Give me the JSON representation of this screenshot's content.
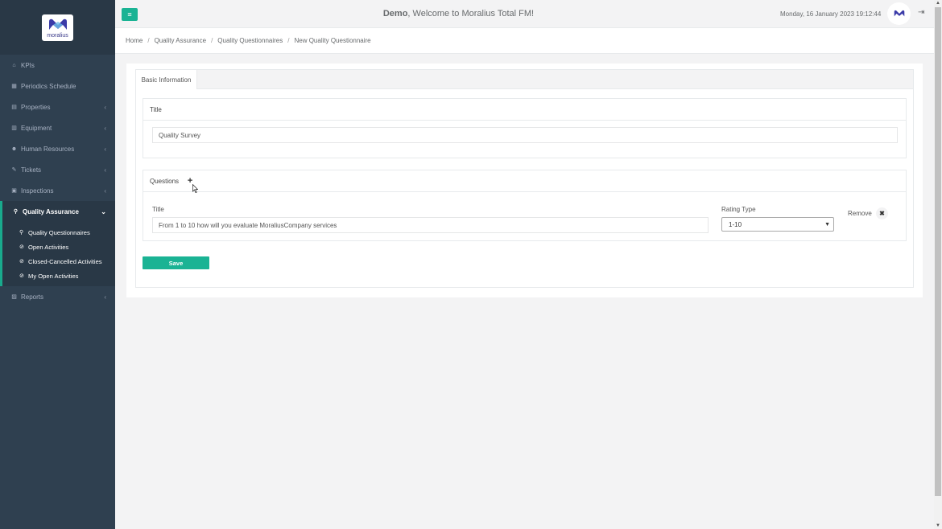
{
  "logo": {
    "text": "moralius"
  },
  "sidebar": {
    "items": [
      {
        "label": "KPIs",
        "icon": "home-icon",
        "glyph": "⌂",
        "chevron": false
      },
      {
        "label": "Periodics Schedule",
        "icon": "calendar-icon",
        "glyph": "▦",
        "chevron": false
      },
      {
        "label": "Properties",
        "icon": "building-icon",
        "glyph": "▤",
        "chevron": true
      },
      {
        "label": "Equipment",
        "icon": "clipboard-icon",
        "glyph": "▥",
        "chevron": true
      },
      {
        "label": "Human Resources",
        "icon": "users-icon",
        "glyph": "☻",
        "chevron": true
      },
      {
        "label": "Tickets",
        "icon": "ticket-icon",
        "glyph": "✎",
        "chevron": true
      },
      {
        "label": "Inspections",
        "icon": "map-icon",
        "glyph": "▣",
        "chevron": true
      },
      {
        "label": "Quality Assurance",
        "icon": "search-icon",
        "glyph": "⚲",
        "chevron": true,
        "active": true
      },
      {
        "label": "Reports",
        "icon": "book-icon",
        "glyph": "▨",
        "chevron": true
      }
    ],
    "sub_items": [
      {
        "label": "Quality Questionnaires",
        "icon": "search-icon",
        "glyph": "⚲"
      },
      {
        "label": "Open Activities",
        "icon": "check-circle-icon",
        "glyph": "⊘"
      },
      {
        "label": "Closed-Cancelled Activities",
        "icon": "check-circle-icon",
        "glyph": "⊘"
      },
      {
        "label": "My Open Activities",
        "icon": "check-circle-icon",
        "glyph": "⊘"
      }
    ]
  },
  "header": {
    "menu_icon": "≡",
    "welcome_bold": "Demo",
    "welcome_text": ", Welcome to Moralius Total FM!",
    "datetime": "Monday, 16 January 2023 19:12:44",
    "logout_icon": "⇥"
  },
  "breadcrumb": [
    "Home",
    "Quality Assurance",
    "Quality Questionnaires",
    "New Quality Questionnaire"
  ],
  "form": {
    "tab_label": "Basic Information",
    "title_section": {
      "heading": "Title",
      "value": "Quality Survey"
    },
    "questions_section": {
      "heading": "Questions",
      "add_icon": "+",
      "question": {
        "title_label": "Title",
        "title_value": "From 1 to 10 how will you evaluate MoraliusCompany services",
        "rating_label": "Rating Type",
        "rating_value": "1-10",
        "remove_label": "Remove",
        "remove_icon": "✖"
      }
    },
    "save_label": "Save"
  },
  "colors": {
    "sidebar": "#2f4050",
    "accent": "#1ab394"
  }
}
